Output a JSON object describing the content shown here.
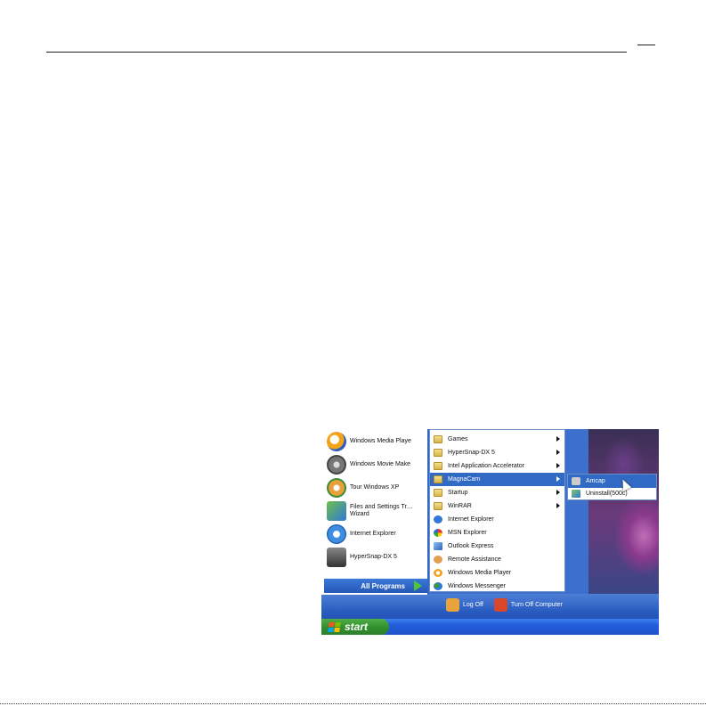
{
  "page": {
    "header_rule": true
  },
  "left_pane": {
    "items": [
      {
        "label": "Windows Media Playe",
        "icon": "media-player-icon",
        "color": "#f2a21b"
      },
      {
        "label": "Windows Movie Make",
        "icon": "movie-maker-icon",
        "color": "#7a7a7a"
      },
      {
        "label": "Tour Windows XP",
        "icon": "tour-xp-icon",
        "color": "#d9892b"
      },
      {
        "label": "Files and Settings Tr… Wizard",
        "icon": "transfer-wizard-icon",
        "color": "#4a9a3a"
      },
      {
        "label": "Internet Explorer",
        "icon": "internet-explorer-icon",
        "color": "#2f78d8"
      },
      {
        "label": "HyperSnap-DX 5",
        "icon": "hypersnap-icon",
        "color": "#555"
      }
    ],
    "all_programs": "All Programs"
  },
  "programs_menu": {
    "items": [
      {
        "label": "Games",
        "icon": "folder-icon",
        "submenu": true
      },
      {
        "label": "HyperSnap-DX 5",
        "icon": "folder-icon",
        "submenu": true
      },
      {
        "label": "Intel Application Accelerator",
        "icon": "folder-icon",
        "submenu": true
      },
      {
        "label": "MagnaCam",
        "icon": "folder-icon",
        "submenu": true,
        "selected": true
      },
      {
        "label": "Startup",
        "icon": "folder-icon",
        "submenu": true
      },
      {
        "label": "WinRAR",
        "icon": "folder-icon",
        "submenu": true
      },
      {
        "label": "Internet Explorer",
        "icon": "internet-explorer-icon",
        "submenu": false
      },
      {
        "label": "MSN Explorer",
        "icon": "msn-icon",
        "submenu": false
      },
      {
        "label": "Outlook Express",
        "icon": "outlook-icon",
        "submenu": false
      },
      {
        "label": "Remote Assistance",
        "icon": "remote-assistance-icon",
        "submenu": false
      },
      {
        "label": "Windows Media Player",
        "icon": "media-player-icon",
        "submenu": false
      },
      {
        "label": "Windows Messenger",
        "icon": "messenger-icon",
        "submenu": false
      }
    ]
  },
  "submenu": {
    "items": [
      {
        "label": "Amcap",
        "icon": "camera-icon",
        "selected": true
      },
      {
        "label": "Uninstall(500c)",
        "icon": "uninstall-icon",
        "selected": false
      }
    ]
  },
  "footer": {
    "log_off": "Log Off",
    "turn_off": "Turn Off Computer"
  },
  "taskbar": {
    "start_label": "start"
  },
  "colors": {
    "selection": "#316ac5",
    "taskbar": "#245ddb",
    "start_green": "#2f8c2b"
  }
}
